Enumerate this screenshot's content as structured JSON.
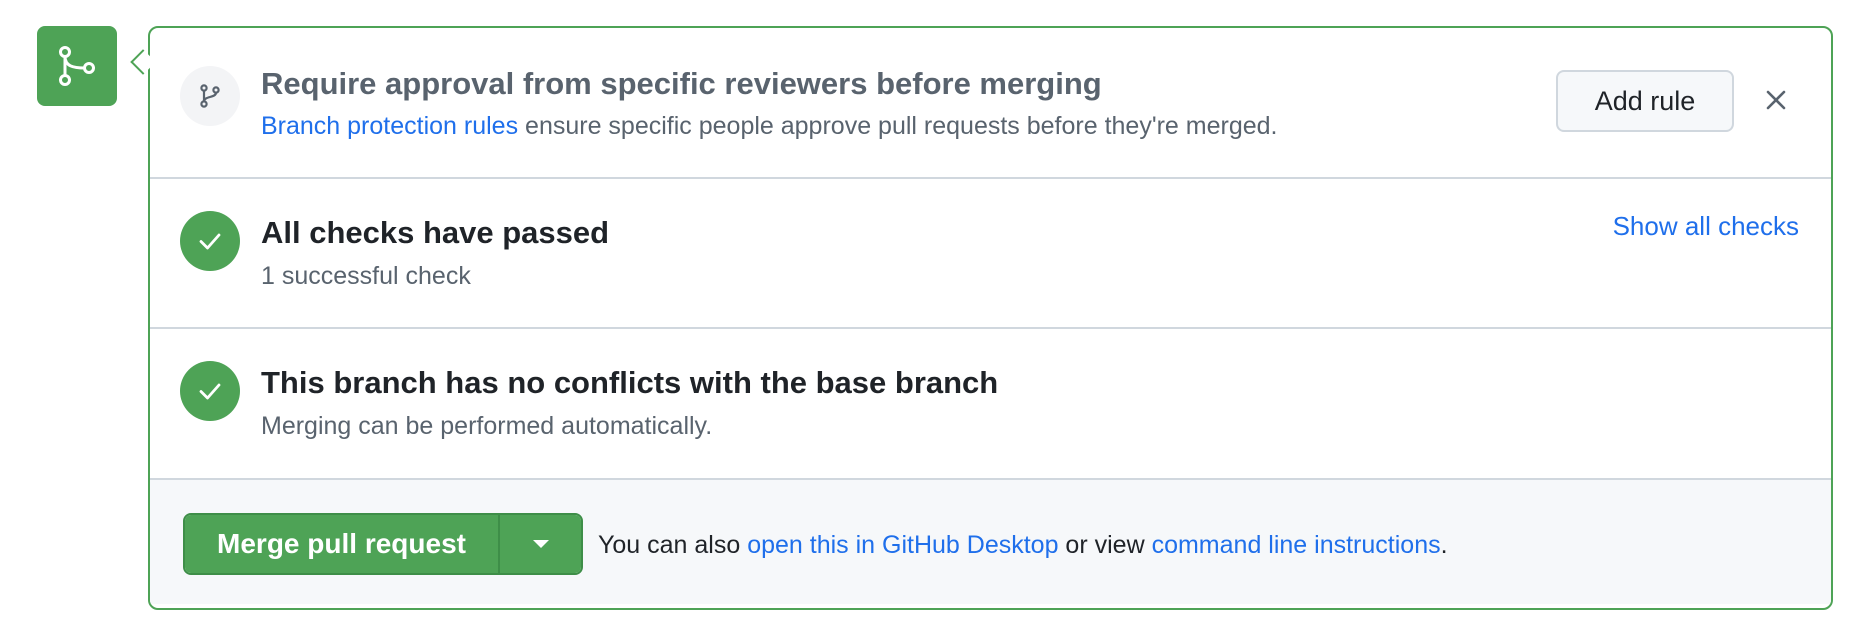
{
  "review_section": {
    "title": "Require approval from specific reviewers before merging",
    "description_link": "Branch protection rules",
    "description_rest": " ensure specific people approve pull requests before they're merged.",
    "add_rule_label": "Add rule",
    "icon": "git-branch-icon",
    "dismiss_icon": "close-icon"
  },
  "checks_section": {
    "title": "All checks have passed",
    "subtitle": "1 successful check",
    "show_all_label": "Show all checks",
    "icon": "check-circle-icon"
  },
  "conflicts_section": {
    "title": "This branch has no conflicts with the base branch",
    "subtitle": "Merging can be performed automatically.",
    "icon": "check-circle-icon"
  },
  "merge_section": {
    "merge_button_label": "Merge pull request",
    "dropdown_icon": "triangle-down-icon",
    "note_prefix": "You can also ",
    "desktop_link": "open this in GitHub Desktop",
    "note_middle": " or view ",
    "cli_link": "command line instructions",
    "note_suffix": "."
  },
  "timeline_badge": {
    "icon": "git-merge-icon"
  },
  "colors": {
    "success_green": "#4ea356",
    "link_blue": "#1f6feb",
    "border_grey": "#d0d7de",
    "muted_text": "#59636e"
  }
}
